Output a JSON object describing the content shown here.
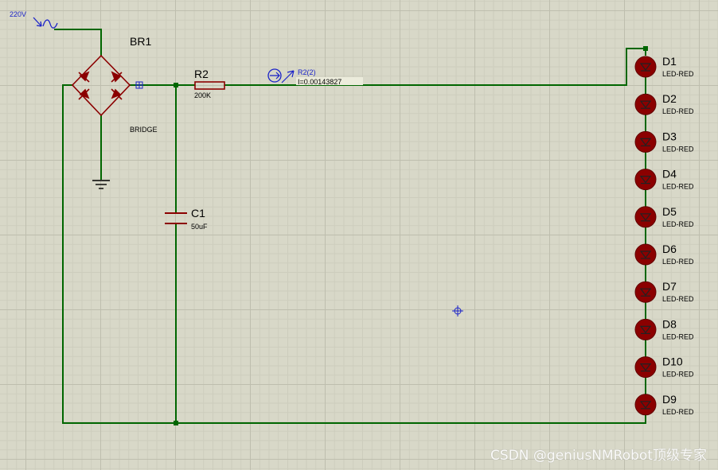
{
  "source": {
    "label": "220V"
  },
  "bridge": {
    "ref": "BR1",
    "value": "BRIDGE"
  },
  "resistor": {
    "ref": "R2",
    "value": "200K"
  },
  "capacitor": {
    "ref": "C1",
    "value": "50uF"
  },
  "probe": {
    "name": "R2(2)",
    "reading": "I=0.00143827"
  },
  "leds": [
    {
      "ref": "D1",
      "value": "LED-RED"
    },
    {
      "ref": "D2",
      "value": "LED-RED"
    },
    {
      "ref": "D3",
      "value": "LED-RED"
    },
    {
      "ref": "D4",
      "value": "LED-RED"
    },
    {
      "ref": "D5",
      "value": "LED-RED"
    },
    {
      "ref": "D6",
      "value": "LED-RED"
    },
    {
      "ref": "D7",
      "value": "LED-RED"
    },
    {
      "ref": "D8",
      "value": "LED-RED"
    },
    {
      "ref": "D10",
      "value": "LED-RED"
    },
    {
      "ref": "D9",
      "value": "LED-RED"
    }
  ],
  "watermark": "CSDN @geniusNMRobot顶级专家",
  "colors": {
    "wire": "#006600",
    "component": "#8b0000",
    "probe": "#1a22c8",
    "grid": "#d8d8c8"
  }
}
